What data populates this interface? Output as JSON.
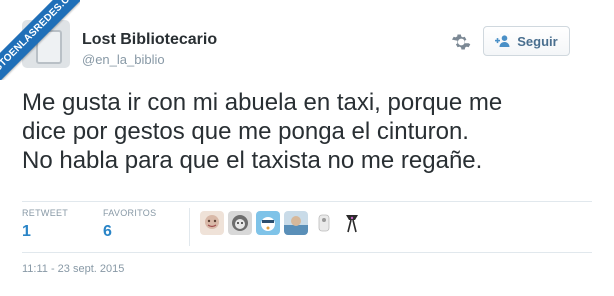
{
  "watermark": {
    "text": "VISTOENLASREDES.COM",
    "color": "#1f6fb8"
  },
  "author": {
    "display_name": "Lost Bibliotecario",
    "username": "@en_la_biblio",
    "avatar_icon": "avatar-image"
  },
  "actions": {
    "gear_icon": "gear-icon",
    "follow_label": "Seguir",
    "follow_icon": "add-user-icon"
  },
  "tweet": {
    "lines": [
      "Me gusta ir con mi abuela en taxi, porque me",
      "dice por gestos que me ponga el cinturon.",
      "No habla para que el taxista no me regañe."
    ]
  },
  "stats": {
    "retweets_label": "RETWEET",
    "retweets_value": "1",
    "favorites_label": "FAVORITOS",
    "favorites_value": "6"
  },
  "favoriters": [
    {
      "name": "favoriter-avatar",
      "color": "#d9b9a8"
    },
    {
      "name": "favoriter-avatar",
      "color": "#6d6d6d"
    },
    {
      "name": "favoriter-avatar",
      "color": "#7fc3e8"
    },
    {
      "name": "favoriter-avatar",
      "color": "#5a8fb8"
    },
    {
      "name": "favoriter-avatar",
      "color": "#eaeaea"
    },
    {
      "name": "favoriter-avatar",
      "color": "#2a2a2a"
    }
  ],
  "timestamp": "11:11 - 23 sept. 2015",
  "colors": {
    "text": "#292f33",
    "muted": "#8899a6",
    "link": "#2a85c7",
    "border": "#e1e8ed"
  }
}
